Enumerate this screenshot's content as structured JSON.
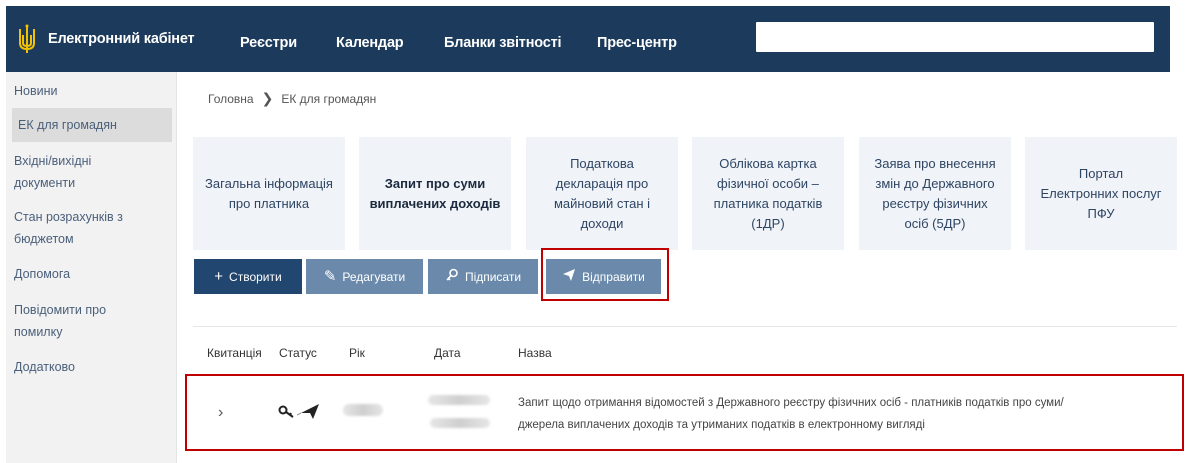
{
  "header": {
    "brand": "Електронний кабінет",
    "nav": [
      "Реєстри",
      "Календар",
      "Бланки звітності",
      "Прес-центр"
    ],
    "search_placeholder": ""
  },
  "sidebar": {
    "items": [
      {
        "label": "Новини"
      },
      {
        "label": "ЕК для громадян"
      },
      {
        "label": "Вхідні/вихідні"
      },
      {
        "label": "документи"
      },
      {
        "label": "Стан розрахунків з"
      },
      {
        "label": "бюджетом"
      },
      {
        "label": "Допомога"
      },
      {
        "label": "Повідомити про"
      },
      {
        "label": "помилку"
      },
      {
        "label": "Додатково"
      }
    ]
  },
  "breadcrumb": {
    "home": "Головна",
    "current": "ЕК для громадян"
  },
  "tiles": [
    {
      "lines": [
        "Загальна інформація",
        "про платника"
      ]
    },
    {
      "lines": [
        "Запит про суми",
        "виплачених доходів"
      ]
    },
    {
      "lines": [
        "Податкова",
        "декларація про",
        "майновий стан і",
        "доходи"
      ]
    },
    {
      "lines": [
        "Облікова картка",
        "фізичної особи –",
        "платника податків",
        "(1ДР)"
      ]
    },
    {
      "lines": [
        "Заява про внесення",
        "змін до Державного",
        "реєстру фізичних",
        "осіб (5ДР)"
      ]
    },
    {
      "lines": [
        "Портал",
        "Електронних послуг",
        "ПФУ"
      ]
    }
  ],
  "toolbar": {
    "create": "Створити",
    "edit": "Редагувати",
    "sign": "Підписати",
    "send": "Відправити"
  },
  "table": {
    "columns": [
      "Квитанція",
      "Статус",
      "Рік",
      "Дата",
      "Назва"
    ],
    "row": {
      "name_line1": "Запит щодо отримання відомостей з Державного реєстру фізичних осіб - платників податків про суми/",
      "name_line2": "джерела виплачених доходів та утриманих податків в електронному вигляді"
    }
  },
  "colors": {
    "header_bg": "#1c3a5b",
    "button_primary": "#21466f",
    "button_secondary": "#6b8aab",
    "highlight": "#c00000",
    "tile_bg": "#f0f3f7"
  },
  "icons": [
    "trident-logo-icon",
    "plus-icon",
    "pencil-icon",
    "key-icon",
    "send-icon",
    "chevron-right-icon",
    "signed-key-icon"
  ]
}
